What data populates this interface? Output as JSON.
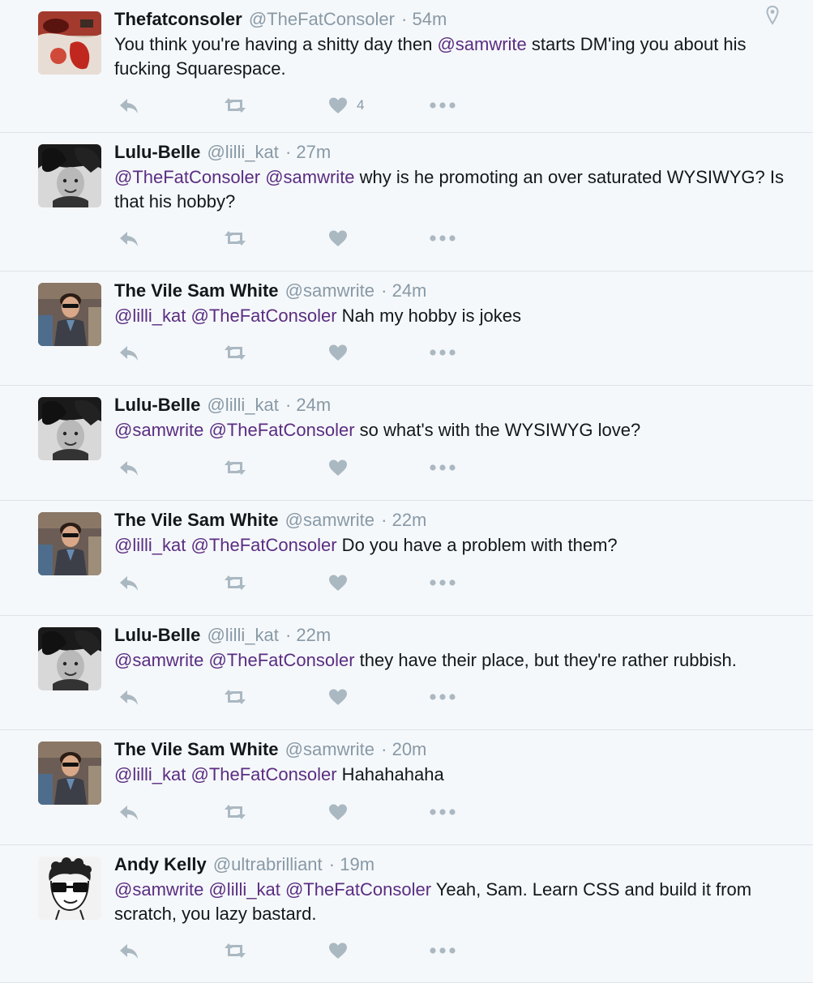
{
  "tweets": [
    {
      "name": "Thefatconsoler",
      "handle": "@TheFatConsoler",
      "time": "· 54m",
      "avatar": "avatar-red",
      "has_location": true,
      "segments": [
        {
          "t": "You think you're having a shitty day then ",
          "m": false
        },
        {
          "t": "@samwrite",
          "m": true
        },
        {
          "t": " starts DM'ing you about his fucking Squarespace.",
          "m": false
        }
      ],
      "like_count": "4"
    },
    {
      "name": "Lulu-Belle",
      "handle": "@lilli_kat",
      "time": "· 27m",
      "avatar": "avatar-lulu",
      "has_location": false,
      "segments": [
        {
          "t": "@TheFatConsoler",
          "m": true
        },
        {
          "t": " ",
          "m": false
        },
        {
          "t": "@samwrite",
          "m": true
        },
        {
          "t": " why is he promoting an over saturated WYSIWYG? Is that his hobby?",
          "m": false
        }
      ],
      "like_count": ""
    },
    {
      "name": "The Vile Sam White",
      "handle": "@samwrite",
      "time": "· 24m",
      "avatar": "avatar-sam",
      "has_location": false,
      "segments": [
        {
          "t": "@lilli_kat",
          "m": true
        },
        {
          "t": " ",
          "m": false
        },
        {
          "t": "@TheFatConsoler",
          "m": true
        },
        {
          "t": " Nah my hobby is jokes",
          "m": false
        }
      ],
      "like_count": ""
    },
    {
      "name": "Lulu-Belle",
      "handle": "@lilli_kat",
      "time": "· 24m",
      "avatar": "avatar-lulu",
      "has_location": false,
      "segments": [
        {
          "t": "@samwrite",
          "m": true
        },
        {
          "t": " ",
          "m": false
        },
        {
          "t": "@TheFatConsoler",
          "m": true
        },
        {
          "t": " so what's with the WYSIWYG love?",
          "m": false
        }
      ],
      "like_count": ""
    },
    {
      "name": "The Vile Sam White",
      "handle": "@samwrite",
      "time": "· 22m",
      "avatar": "avatar-sam",
      "has_location": false,
      "segments": [
        {
          "t": "@lilli_kat",
          "m": true
        },
        {
          "t": " ",
          "m": false
        },
        {
          "t": "@TheFatConsoler",
          "m": true
        },
        {
          "t": " Do you have a problem with them?",
          "m": false
        }
      ],
      "like_count": ""
    },
    {
      "name": "Lulu-Belle",
      "handle": "@lilli_kat",
      "time": "· 22m",
      "avatar": "avatar-lulu",
      "has_location": false,
      "segments": [
        {
          "t": "@samwrite",
          "m": true
        },
        {
          "t": " ",
          "m": false
        },
        {
          "t": "@TheFatConsoler",
          "m": true
        },
        {
          "t": " they have their place, but they're rather rubbish.",
          "m": false
        }
      ],
      "like_count": ""
    },
    {
      "name": "The Vile Sam White",
      "handle": "@samwrite",
      "time": "· 20m",
      "avatar": "avatar-sam",
      "has_location": false,
      "segments": [
        {
          "t": "@lilli_kat",
          "m": true
        },
        {
          "t": " ",
          "m": false
        },
        {
          "t": "@TheFatConsoler",
          "m": true
        },
        {
          "t": " Hahahahaha",
          "m": false
        }
      ],
      "like_count": ""
    },
    {
      "name": "Andy Kelly",
      "handle": "@ultrabrilliant",
      "time": "· 19m",
      "avatar": "avatar-andy",
      "has_location": false,
      "segments": [
        {
          "t": "@samwrite",
          "m": true
        },
        {
          "t": " ",
          "m": false
        },
        {
          "t": "@lilli_kat",
          "m": true
        },
        {
          "t": " ",
          "m": false
        },
        {
          "t": "@TheFatConsoler",
          "m": true
        },
        {
          "t": " Yeah, Sam. Learn CSS and build it from scratch, you lazy bastard.",
          "m": false
        }
      ],
      "like_count": ""
    }
  ],
  "icons": {
    "reply": "reply-icon",
    "retweet": "retweet-icon",
    "like": "heart-icon",
    "more": "more-dots-icon",
    "location": "location-pin-icon"
  },
  "colors": {
    "background": "#f5f8fa",
    "mention": "#5a2d82",
    "meta": "#8899a6",
    "icon": "#aab8c2",
    "divider": "#dde3e8"
  }
}
